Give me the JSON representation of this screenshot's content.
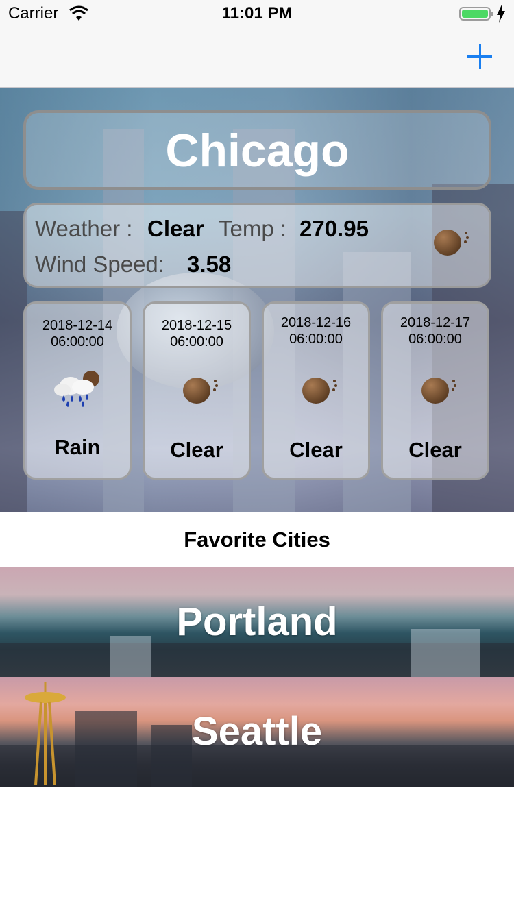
{
  "status_bar": {
    "carrier": "Carrier",
    "time": "11:01 PM"
  },
  "nav": {
    "add_icon": "plus-icon",
    "accent_color": "#1a7ff0"
  },
  "current": {
    "city": "Chicago",
    "weather_label": "Weather :",
    "weather_value": "Clear",
    "temp_label": "Temp :",
    "temp_value": "270.95",
    "wind_label": "Wind Speed:",
    "wind_value": "3.58",
    "icon": "clear-sun-icon"
  },
  "forecast": [
    {
      "date": "2018-12-14",
      "time": "06:00:00",
      "condition": "Rain",
      "icon": "rain-cloud-icon"
    },
    {
      "date": "2018-12-15",
      "time": "06:00:00",
      "condition": "Clear",
      "icon": "clear-sun-icon"
    },
    {
      "date": "2018-12-16",
      "time": "06:00:00",
      "condition": "Clear",
      "icon": "clear-sun-icon"
    },
    {
      "date": "2018-12-17",
      "time": "06:00:00",
      "condition": "Clear",
      "icon": "clear-sun-icon"
    }
  ],
  "favorites": {
    "title": "Favorite Cities",
    "cities": [
      {
        "name": "Portland"
      },
      {
        "name": "Seattle"
      }
    ]
  }
}
